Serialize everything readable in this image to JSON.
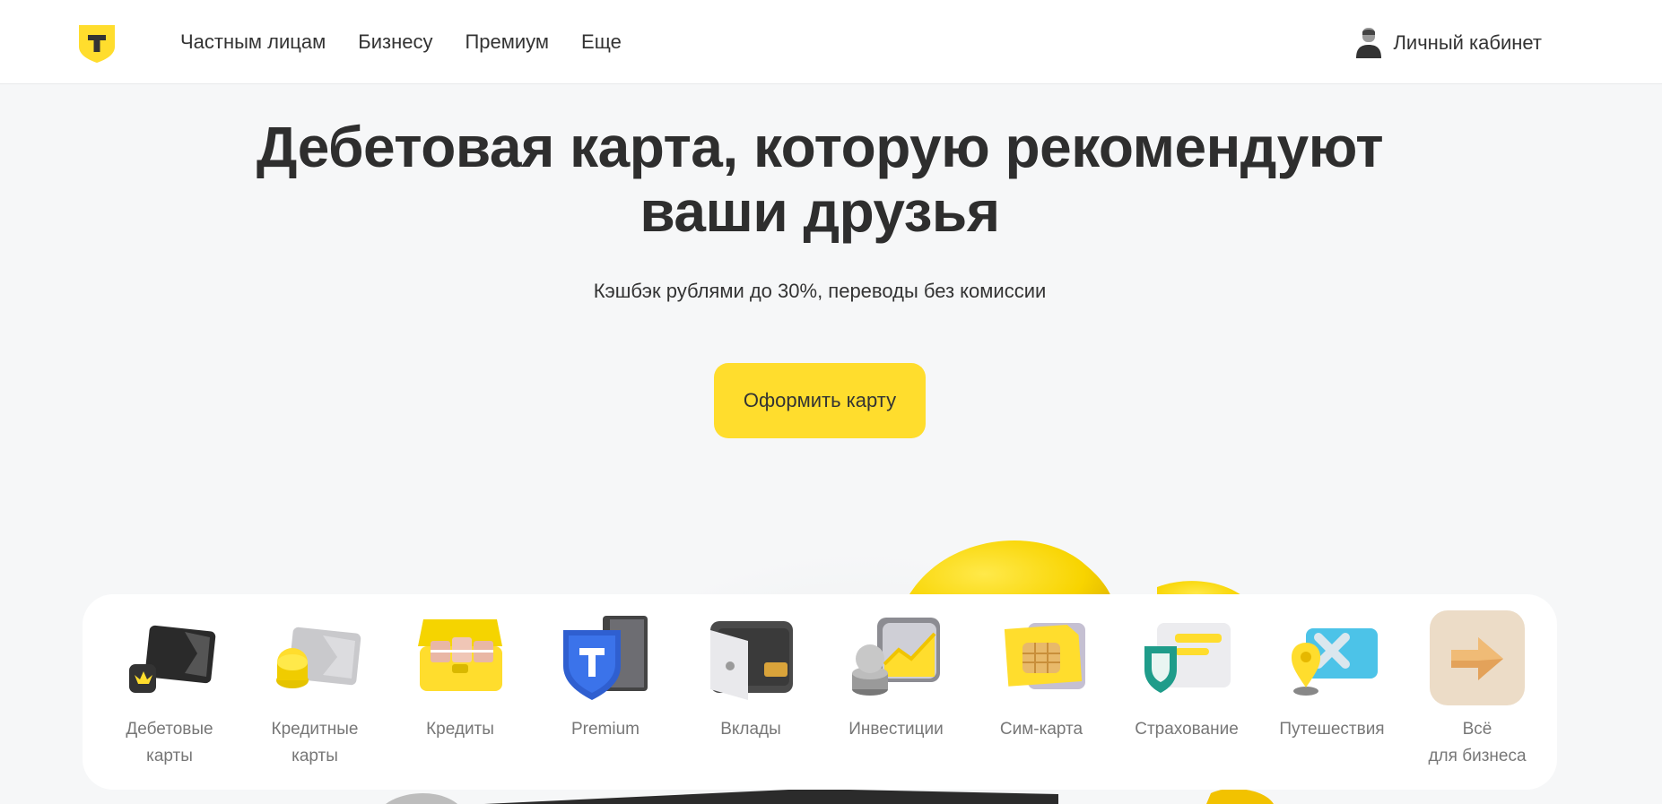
{
  "header": {
    "nav": [
      "Частным лицам",
      "Бизнесу",
      "Премиум",
      "Еще"
    ],
    "cabinet_label": "Личный кабинет"
  },
  "hero": {
    "title_lines": [
      "Дебетовая карта, которую рекомендуют",
      "ваши друзья"
    ],
    "subtitle": "Кэшбэк рублями до 30%, переводы без комиссии",
    "cta_label": "Оформить карту"
  },
  "categories": [
    {
      "label_lines": [
        "Дебетовые",
        "карты"
      ],
      "icon": "debit-card-icon"
    },
    {
      "label_lines": [
        "Кредитные",
        "карты"
      ],
      "icon": "credit-card-icon"
    },
    {
      "label_lines": [
        "Кредиты"
      ],
      "icon": "loans-icon"
    },
    {
      "label_lines": [
        "Premium"
      ],
      "icon": "premium-shield-icon"
    },
    {
      "label_lines": [
        "Вклады"
      ],
      "icon": "deposit-safe-icon"
    },
    {
      "label_lines": [
        "Инвестиции"
      ],
      "icon": "investments-icon"
    },
    {
      "label_lines": [
        "Сим-карта"
      ],
      "icon": "sim-card-icon"
    },
    {
      "label_lines": [
        "Страхование"
      ],
      "icon": "insurance-icon"
    },
    {
      "label_lines": [
        "Путешествия"
      ],
      "icon": "travel-icon"
    },
    {
      "label_lines": [
        "Всё",
        "для бизнеса"
      ],
      "icon": "business-arrow-icon"
    }
  ],
  "colors": {
    "brand_yellow": "#ffdd2d",
    "text_dark": "#333333",
    "page_bg": "#f6f7f8"
  }
}
